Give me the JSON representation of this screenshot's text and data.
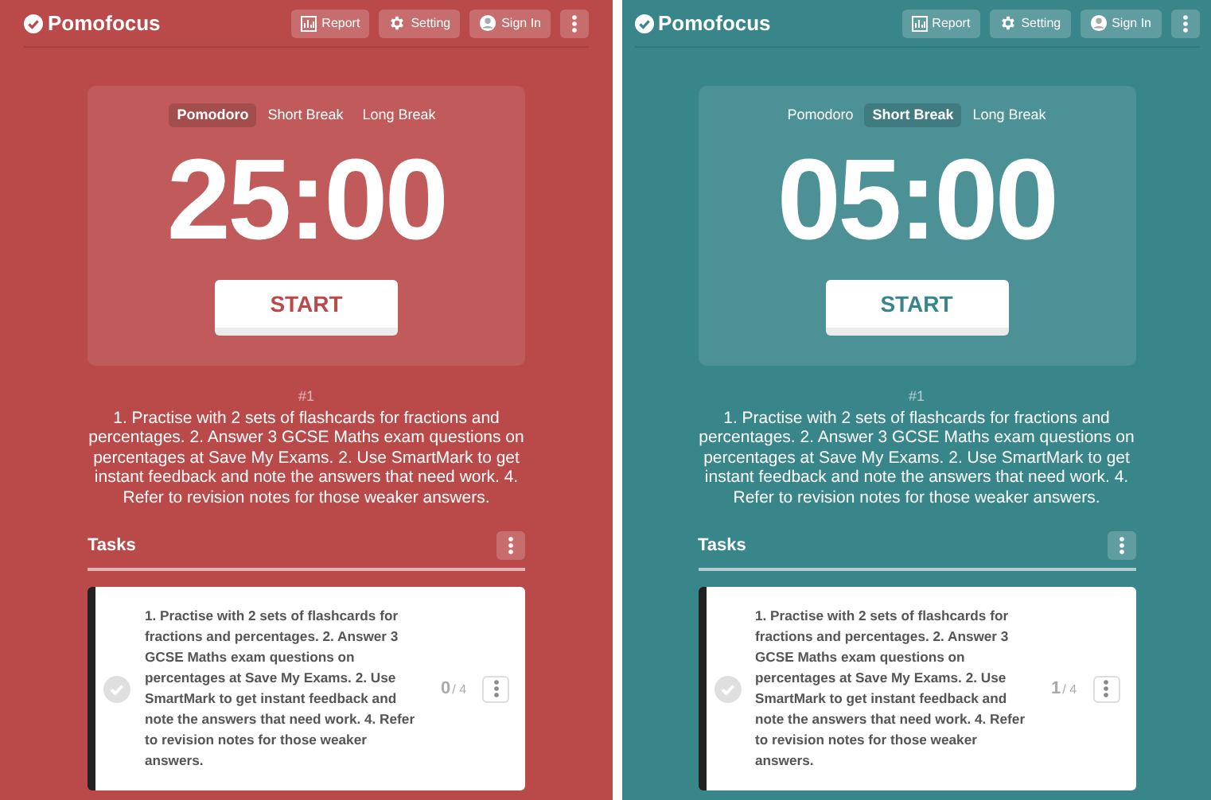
{
  "panels": [
    {
      "color": "#ba4949",
      "app_name": "Pomofocus",
      "nav_buttons": [
        "Report",
        "Setting",
        "Sign In"
      ],
      "modes": [
        {
          "label": "Pomodoro",
          "selected": true
        },
        {
          "label": "Short Break",
          "selected": false
        },
        {
          "label": "Long Break",
          "selected": false
        }
      ],
      "timer": "25:00",
      "start_button": "START",
      "session": "#1",
      "current_task": "1. Practise with 2 sets of flashcards for fractions and percentages. 2. Answer 3 GCSE Maths exam questions on percentages at Save My Exams. 2. Use SmartMark to get instant feedback and note the answers that need work. 4. Refer to revision notes for those weaker answers.",
      "tasks_title": "Tasks",
      "tasks": [
        {
          "text": "1. Practise with 2 sets of flashcards for fractions and percentages. 2. Answer 3 GCSE Maths exam questions on percentages at Save My Exams. 2. Use SmartMark to get instant feedback and note the answers that need work. 4. Refer to revision notes for those weaker answers.",
          "done_count": "0",
          "total": "/ 4",
          "selected": true
        }
      ]
    },
    {
      "color": "#38858a",
      "app_name": "Pomofocus",
      "nav_buttons": [
        "Report",
        "Setting",
        "Sign In"
      ],
      "modes": [
        {
          "label": "Pomodoro",
          "selected": false
        },
        {
          "label": "Short Break",
          "selected": true
        },
        {
          "label": "Long Break",
          "selected": false
        }
      ],
      "timer": "05:00",
      "start_button": "START",
      "session": "#1",
      "current_task": "1. Practise with 2 sets of flashcards for fractions and percentages. 2. Answer 3 GCSE Maths exam questions on percentages at Save My Exams. 2. Use SmartMark to get instant feedback and note the answers that need work. 4. Refer to revision notes for those weaker answers.",
      "tasks_title": "Tasks",
      "tasks": [
        {
          "text": "1. Practise with 2 sets of flashcards for fractions and percentages. 2. Answer 3 GCSE Maths exam questions on percentages at Save My Exams. 2. Use SmartMark to get instant feedback and note the answers that need work. 4. Refer to revision notes for those weaker answers.",
          "done_count": "1",
          "total": "/ 4",
          "selected": true
        }
      ]
    }
  ]
}
